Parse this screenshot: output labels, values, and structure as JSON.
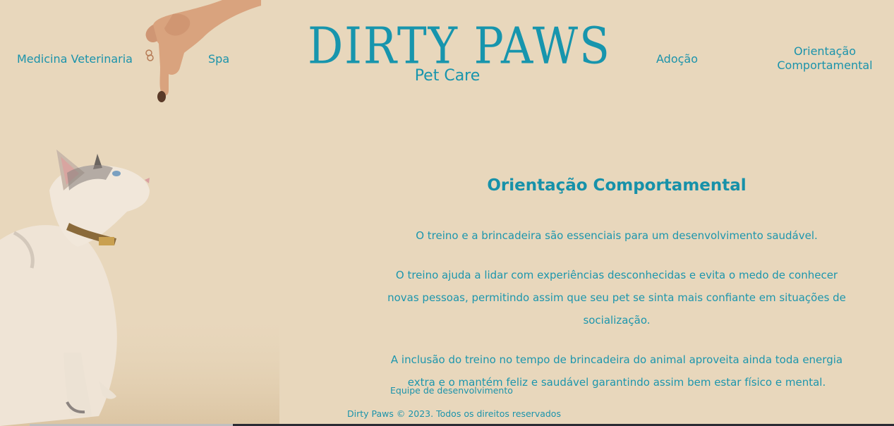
{
  "nav": {
    "medicina": "Medicina Veterinaria",
    "spa": "Spa",
    "adocao": "Adoção",
    "orientacao": "Orientação Comportamental"
  },
  "logo": {
    "title": "DIRTY PAWS",
    "subtitle": "Pet Care"
  },
  "main": {
    "heading": "Orientação Comportamental",
    "paragraphs": [
      "O treino e a brincadeira são essenciais para um desenvolvimento saudável.",
      "O treino ajuda a lidar com experiências desconhecidas e evita o medo de conhecer novas pessoas, permitindo assim que seu pet se sinta mais confiante em situações de socialização.",
      "A inclusão do treino no tempo de brincadeira do animal aproveita ainda toda energia extra e o mantém feliz e saudável garantindo assim bem estar físico e mental."
    ]
  },
  "footer": {
    "team_link": "Equipe de desenvolvimento",
    "copyright": "Dirty Paws © 2023. Todos os direitos reservados"
  },
  "colors": {
    "background": "#e8d7bc",
    "accent": "#1795ad"
  },
  "images": {
    "hand": "hand-holding-treat",
    "cat": "cat-looking-up"
  }
}
